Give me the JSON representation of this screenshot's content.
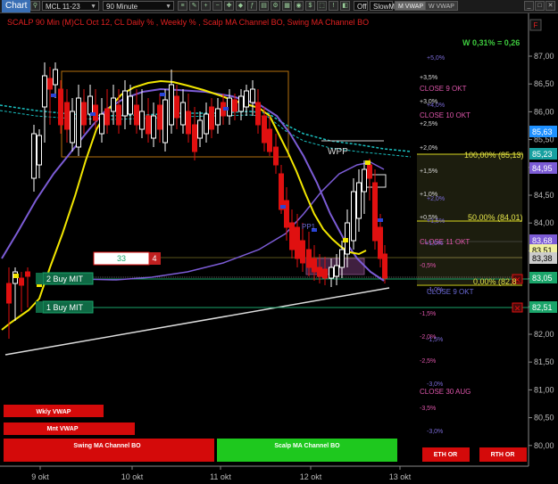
{
  "toolbar": {
    "chart_tab": "Chart",
    "symbol": "MCL 11-23",
    "interval": "90 Minute",
    "indicator_select": "SlowMA",
    "btn_m_vwap": "M VWAP",
    "btn_w_vwap": "W VWAP",
    "off_label": "Off",
    "icon_f": "F"
  },
  "chart": {
    "title": "SCALP 90 Min (M)CL Oct 12, CL Daily % , Weekly % , Scalp MA Channel BO, Swing MA Channel BO",
    "w_label": "W 0,31% = 0,26",
    "wpp_label": "WPP",
    "pp1_label": "PP1",
    "fib_100": "100,00% (85,13)",
    "fib_50": "50,00% (84,01)",
    "fib_0": "0,00% (82,8",
    "buy2_label": "2 Buy MIT",
    "buy1_label": "1 Buy MIT",
    "order_qty": "33",
    "order_num": "4",
    "close_labels": [
      "CLOSE 9 OKT",
      "CLOSE 10 OKT",
      "CLOSE 11 OKT",
      "CLOSE 9 OKT",
      "CLOSE 30 AUG"
    ],
    "pct_labels": [
      "+5,0%",
      "+3,5%",
      "+4,0%",
      "+3,0%",
      "+2,5%",
      "+2,0%",
      "+1,5%",
      "+1,0%",
      "+0,5%",
      "+1,0%",
      "-0,5%",
      "-1,0%",
      "-1,5%",
      "-2,0%",
      "-1,5%",
      "-2,5%",
      "-3,0%",
      "-3,5%",
      "-3,0%",
      "+1,5%",
      "+2,0%"
    ],
    "badges": {
      "wkly_vwap": "Wkly VWAP",
      "mnt_vwap": "Mnt VWAP",
      "swing_bo": "Swing MA Channel BO",
      "scalp_bo": "Scalp MA Channel BO",
      "eth_or": "ETH OR",
      "rth_or": "RTH OR"
    },
    "price_axis": [
      "87,00",
      "86,50",
      "86,00",
      "85,50",
      "85,00",
      "84,50",
      "84,00",
      "83,50",
      "83,00",
      "82,50",
      "82,00",
      "81,50",
      "81,00",
      "80,50",
      "80,00"
    ],
    "price_markers": [
      {
        "text": "85,63",
        "color": "#1e90ff"
      },
      {
        "text": "85,23",
        "color": "#16a0a0"
      },
      {
        "text": "84,95",
        "color": "#7c5cd6"
      },
      {
        "text": "83,68",
        "color": "#7c5cd6"
      },
      {
        "text": "83,51",
        "color": "#f0f0a0"
      },
      {
        "text": "83,38",
        "color": "#cccccc"
      },
      {
        "text": "83,05",
        "color": "#1aa56a"
      },
      {
        "text": "82,51",
        "color": "#1aa56a"
      }
    ],
    "date_axis": [
      "9 okt",
      "10 okt",
      "11 okt",
      "12 okt",
      "13 okt"
    ],
    "colors": {
      "up_candle": "#ffffff",
      "down_candle": "#e01010",
      "yellow_ma": "#f2e600",
      "purple_ma": "#7c5cd6",
      "teal_ma": "#1bc0c0",
      "buy_line": "#1aa56a"
    }
  }
}
